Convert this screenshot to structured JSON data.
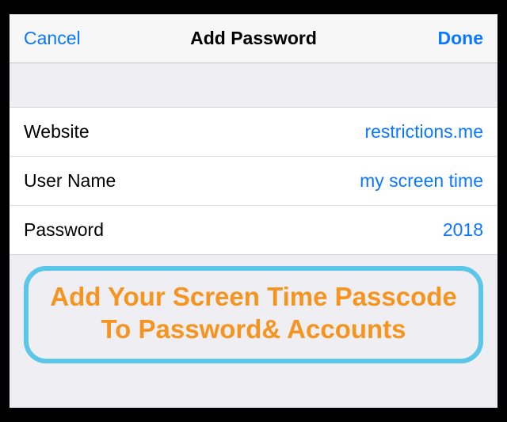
{
  "navbar": {
    "cancel": "Cancel",
    "title": "Add Password",
    "done": "Done"
  },
  "fields": {
    "website": {
      "label": "Website",
      "value": "restrictions.me"
    },
    "username": {
      "label": "User Name",
      "value": "my screen time"
    },
    "password": {
      "label": "Password",
      "value": "2018"
    }
  },
  "callout": {
    "text": "Add Your Screen Time Passcode To Password& Accounts"
  },
  "colors": {
    "accent": "#0b78ff",
    "callout_border": "#5bc6e8",
    "callout_text": "#f5941e"
  }
}
